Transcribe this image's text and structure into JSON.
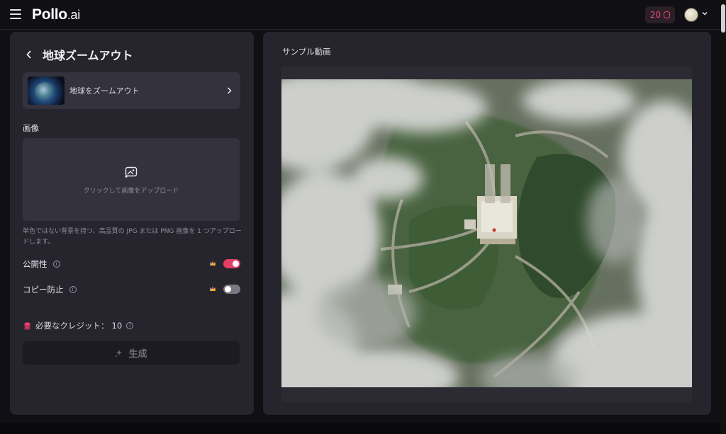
{
  "header": {
    "logo_main": "Pollo",
    "logo_suffix": ".ai",
    "credits": "20"
  },
  "sidebar": {
    "title": "地球ズームアウト",
    "template_label": "地球をズームアウト",
    "image_section_label": "画像",
    "upload_text": "クリックして画像をアップロード",
    "upload_hint": "単色ではない背景を持つ、高品質の JPG または PNG 画像を 1 つアップロードします。",
    "public_label": "公開性",
    "public_enabled": true,
    "copy_protect_label": "コピー防止",
    "copy_protect_enabled": false,
    "credits_label": "必要なクレジット：",
    "credits_value": "10",
    "generate_label": "生成"
  },
  "preview": {
    "label": "サンプル動画"
  },
  "colors": {
    "accent": "#e63e66",
    "panel": "#26252e",
    "background": "#0f0f14"
  }
}
